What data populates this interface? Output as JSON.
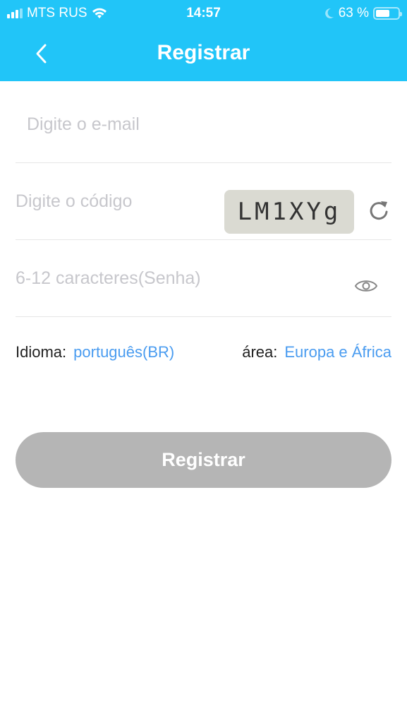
{
  "status_bar": {
    "carrier": "MTS RUS",
    "time": "14:57",
    "battery_percent_text": "63 %",
    "battery_level": 0.63
  },
  "nav": {
    "title": "Registrar",
    "back_icon": "chevron-left-icon"
  },
  "form": {
    "email": {
      "value": "",
      "placeholder": "Digite o e-mail"
    },
    "code": {
      "value": "",
      "placeholder": "Digite o código",
      "captcha_text": "LM1XYg",
      "refresh_icon": "refresh-icon"
    },
    "password": {
      "value": "",
      "placeholder": "6-12 caracteres(Senha)",
      "toggle_icon": "eye-icon"
    }
  },
  "settings": {
    "language_label": "Idioma:",
    "language_value": "português(BR)",
    "area_label": "área:",
    "area_value": "Europa e África"
  },
  "submit_label": "Registrar",
  "colors": {
    "header": "#21c5f8",
    "link": "#4a9cf0",
    "button_disabled": "#b5b5b5"
  }
}
